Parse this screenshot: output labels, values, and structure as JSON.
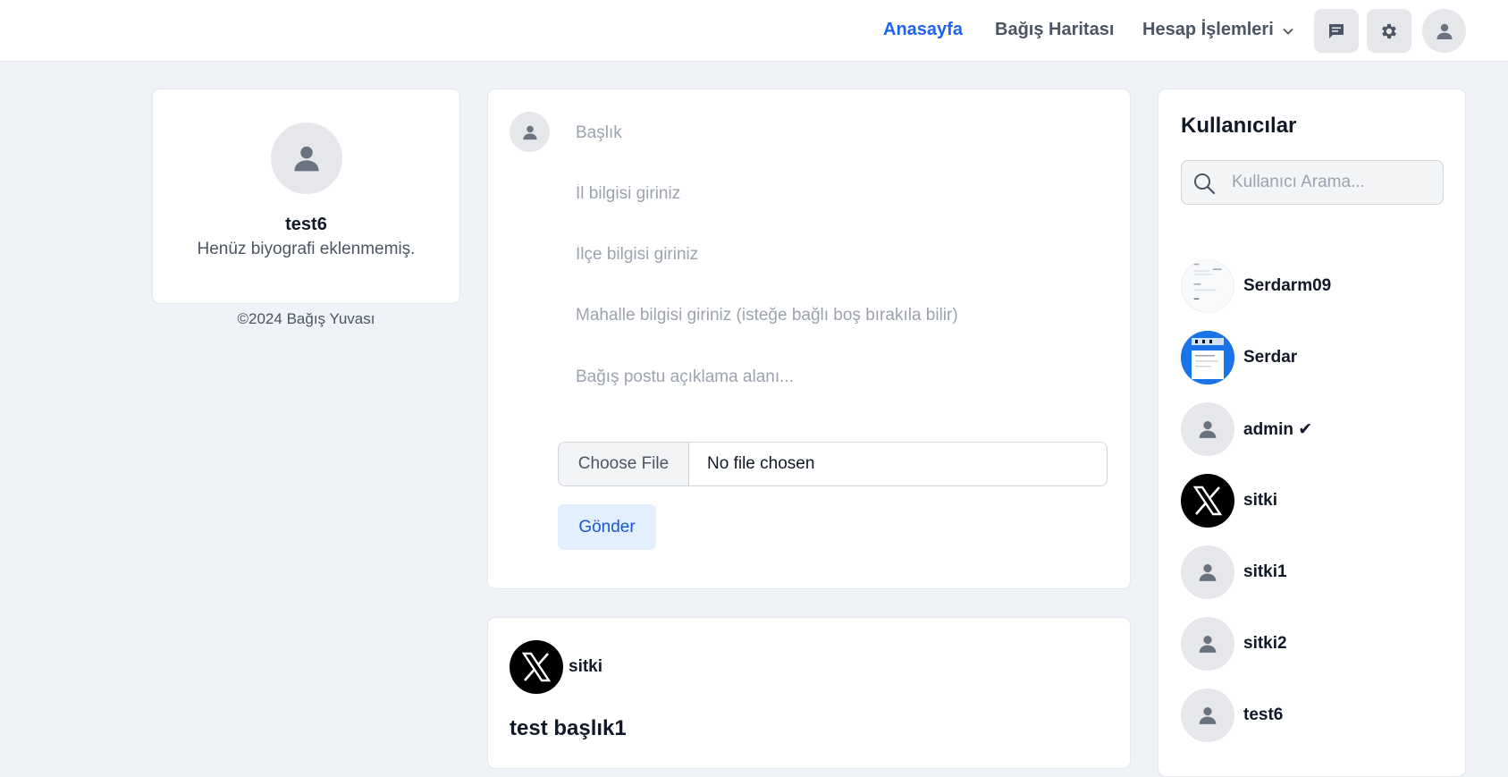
{
  "nav": {
    "home": "Anasayfa",
    "map": "Bağış Haritası",
    "account": "Hesap İşlemleri",
    "messages_icon": "chat-icon",
    "settings_icon": "gear-icon",
    "profile_icon": "user-icon",
    "active_color": "#1c64f2"
  },
  "profile": {
    "username": "test6",
    "bio": "Henüz biyografi eklenmemiş.",
    "footer": "©2024 Bağış Yuvası"
  },
  "post_form": {
    "title_placeholder": "Başlık",
    "city_placeholder": "İl bilgisi giriniz",
    "district_placeholder": "İlçe bilgisi giriniz",
    "neighborhood_placeholder": "Mahalle bilgisi giriniz (isteğe bağlı boş bırakıla bilir)",
    "description_placeholder": "Bağış postu açıklama alanı...",
    "file_button": "Choose File",
    "file_status": "No file chosen",
    "submit": "Gönder"
  },
  "post": {
    "author": "sitki",
    "title": "test başlık1"
  },
  "users": {
    "heading": "Kullanıcılar",
    "search_placeholder": "Kullanıcı Arama...",
    "list": [
      {
        "name": "Serdarm09",
        "avatar": "screenshot-thumbnail"
      },
      {
        "name": "Serdar",
        "avatar": "blue-screenshot-thumbnail"
      },
      {
        "name": "admin ✔",
        "avatar": "default-user-icon"
      },
      {
        "name": "sitki",
        "avatar": "x-logo"
      },
      {
        "name": "sitki1",
        "avatar": "default-user-icon"
      },
      {
        "name": "sitki2",
        "avatar": "default-user-icon"
      },
      {
        "name": "test6",
        "avatar": "default-user-icon"
      }
    ]
  }
}
